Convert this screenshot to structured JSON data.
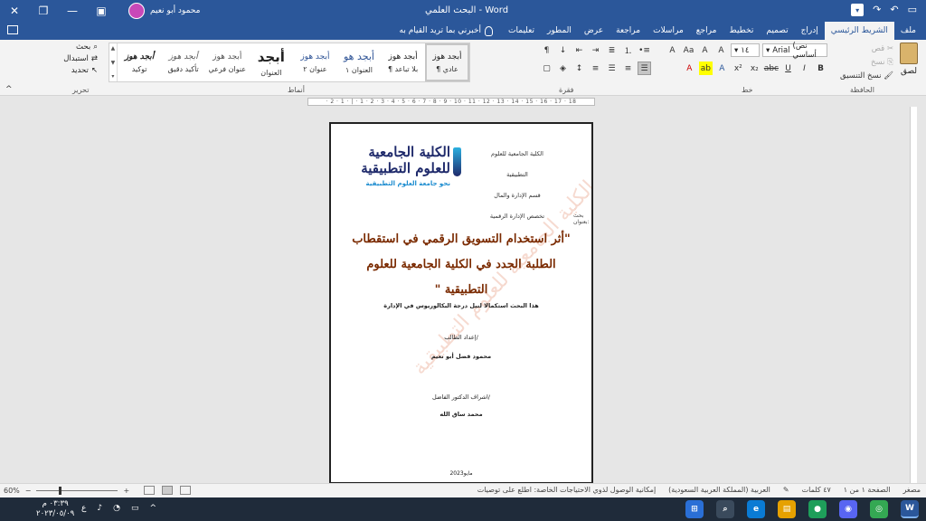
{
  "window": {
    "title": "البحث العلمي - Word",
    "user": "محمود أبو نعيم",
    "qat_dropdown": "▾"
  },
  "tabs": {
    "file": "ملف",
    "home": "الشريط الرئيسي",
    "insert": "إدراج",
    "design": "تصميم",
    "layout": "تخطيط",
    "references": "مراجع",
    "mailings": "مراسلات",
    "review": "مراجعة",
    "view": "عرض",
    "developer": "المطور",
    "help": "تعليمات",
    "tell_me": "أخبرني بما تريد القيام به"
  },
  "ribbon": {
    "clipboard": {
      "paste": "لصق",
      "cut": "قص",
      "copy": "نسخ",
      "format_painter": "نسخ التنسيق",
      "label": "الحافظة"
    },
    "font": {
      "name": "Arial",
      "style_box": "(نص أساسي",
      "size": "١٤",
      "label": "خط",
      "bold": "B",
      "italic": "I",
      "underline": "U",
      "strike": "abc",
      "subscript": "x₂",
      "superscript": "x²",
      "grow": "A",
      "shrink": "A",
      "case": "Aa",
      "clear": "A",
      "highlight": "ab",
      "color": "A"
    },
    "paragraph": {
      "label": "فقرة",
      "show_marks": "¶"
    },
    "styles": {
      "label": "أنماط",
      "items": [
        {
          "preview": "أبجد هوز",
          "name": "¶ عادي"
        },
        {
          "preview": "أبجد هوز",
          "name": "¶ بلا تباعد"
        },
        {
          "preview": "أبجد هو",
          "name": "العنوان ١"
        },
        {
          "preview": "أبجد هوز",
          "name": "عنوان ٢"
        },
        {
          "preview": "أبجد",
          "name": "العنوان"
        },
        {
          "preview": "أبجد هوز",
          "name": "عنوان فرعي"
        },
        {
          "preview": "أبجد هوز",
          "name": "تأكيد دقيق"
        },
        {
          "preview": "أبجد هوز",
          "name": "توكيد"
        }
      ]
    },
    "editing": {
      "label": "تحرير",
      "find": "بحث",
      "replace": "استبدال",
      "select": "تحديد"
    }
  },
  "ruler": {
    "text": "· 2 · 1 · | · 1 · 2 · 3 · 4 · 5 · 6 · 7 · 8 · 9 · 10 · 11 · 12 · 13 · 14 · 15 · 16 · 17 · 18"
  },
  "document": {
    "university_line1": "الكلية الجامعية",
    "university_line2": "للعلوم التطبيقية",
    "university_slogan": "نحو جامعة العلوم التطبيقية",
    "info_college": "الكلية الجامعية للعلوم التطبيقية",
    "info_department": "قسم الإدارة والمال",
    "info_major": "تخصص الإدارة الرقمية",
    "research_label": "بحث بعنوان:",
    "title": "\"أثر استخدام التسويق الرقمي في استقطاب الطلبة الجدد في الكلية الجامعية للعلوم التطبيقية \"",
    "subtitle": "هذا البحث استكمالا لنيل درجة البكالوريوس في الإدارة",
    "prepared_by_label": "إعداد الطالب/",
    "student_name": "محمود فضل أبو نعيم",
    "supervisor_label": "اشراف الدكتور الفاضل/",
    "supervisor_name": "محمد ساق الله",
    "year": "مايو2023",
    "watermark": "الكلية الجامعية للعلوم التطبيقية"
  },
  "status": {
    "page": "الصفحة ١ من ١",
    "words": "٤٧ كلمات",
    "language": "العربية (المملكة العربية السعودية)",
    "accessibility": "إمكانية الوصول لذوي الاحتياجات الخاصة: اطلع على توصيات",
    "focus": "مصغر",
    "zoom": "60%",
    "zoom_level": 0.6
  },
  "taskbar": {
    "time": "٠٣:٣٩ م",
    "date": "٢٠٢٣/٠٥/٠٩",
    "lang": "ع"
  },
  "colors": {
    "word_blue": "#2b579a",
    "title_brown": "#7a2a00",
    "logo_navy": "#1f2a6b",
    "logo_cyan": "#1a8bcf"
  }
}
